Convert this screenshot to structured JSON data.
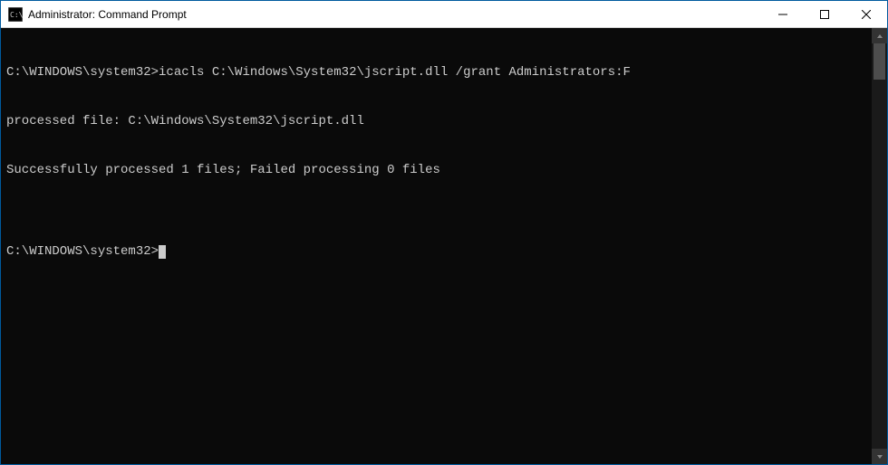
{
  "window": {
    "title": "Administrator: Command Prompt"
  },
  "controls": {
    "minimize": "Minimize",
    "maximize": "Maximize",
    "close": "Close"
  },
  "console": {
    "prompt1": "C:\\WINDOWS\\system32>",
    "command1": "icacls C:\\Windows\\System32\\jscript.dll /grant Administrators:F",
    "line2": "processed file: C:\\Windows\\System32\\jscript.dll",
    "line3": "Successfully processed 1 files; Failed processing 0 files",
    "blankline": "",
    "prompt2": "C:\\WINDOWS\\system32>"
  }
}
